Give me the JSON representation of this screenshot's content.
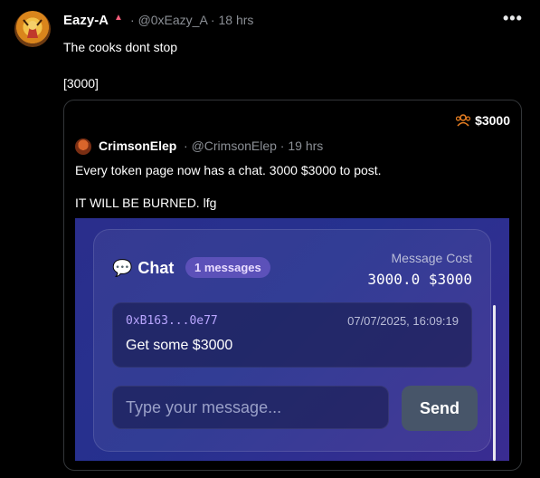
{
  "post": {
    "author_name": "Eazy-A",
    "handle": "@0xEazy_A",
    "time": "18 hrs",
    "badge": "▲",
    "text_line1": "The cooks dont stop",
    "text_line2": "[3000]"
  },
  "quote": {
    "price": "$3000",
    "author_name": "CrimsonElep",
    "handle": "@CrimsonElep",
    "time": "19 hrs",
    "text_line1": "Every token page now has a chat. 3000 $3000 to post.",
    "text_line2": "IT WILL BE BURNED. lfg"
  },
  "chat": {
    "title": "Chat",
    "message_count": "1 messages",
    "cost_label": "Message Cost",
    "cost_value": "3000.0 $3000",
    "message": {
      "address": "0xB163...0e77",
      "timestamp": "07/07/2025, 16:09:19",
      "body": "Get some $3000"
    },
    "input_placeholder": "Type your message...",
    "send_label": "Send"
  },
  "icons": {
    "more": "more-dots-icon",
    "group": "group-icon",
    "chat": "chat-bubble-icon"
  },
  "colors": {
    "background": "#000000",
    "accent_orange": "#e67e22",
    "chat_gradient": "#2a2e8c"
  }
}
